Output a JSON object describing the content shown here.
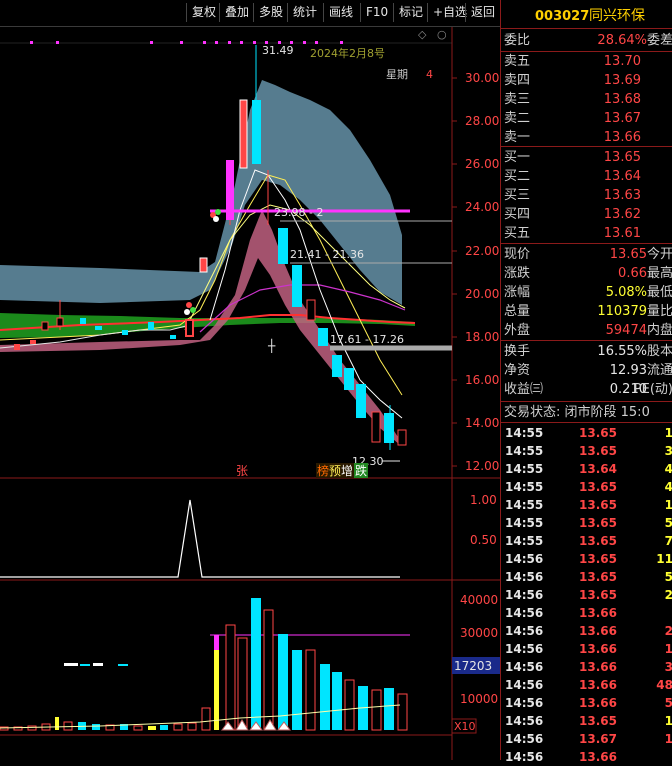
{
  "toolbar": {
    "items": [
      "复权",
      "叠加",
      "多股",
      "统计",
      "画线",
      "F10",
      "标记",
      "+自选",
      "返回"
    ]
  },
  "chart": {
    "price_axis": [
      "30.00",
      "28.00",
      "26.00",
      "24.00",
      "22.00",
      "20.00",
      "18.00",
      "16.00",
      "14.00",
      "12.00"
    ],
    "indicator_axis": [
      "1.00",
      "0.50"
    ],
    "volume_axis": [
      "40000",
      "30000",
      "20000",
      "10000"
    ],
    "volume_marker": "17203",
    "volume_scale": "X10",
    "high_label": "31.49",
    "low_label": "12.30",
    "date_label": "2024年2月8号",
    "weekday_label": "星期",
    "weekday_value": "4",
    "level_24": "23.98 - 2",
    "level_21": "21.41 - 21.36",
    "level_17": "17.61 - 17.26",
    "tag_zhang": "张",
    "tag_bang": "榜",
    "tag_yu": "预",
    "tag_zeng": "增",
    "tag_die": "跌"
  },
  "quote": {
    "code": "003027",
    "name": "同兴环保",
    "weibi": {
      "label": "委比",
      "value": "28.64%",
      "right": "委差"
    },
    "sells": [
      {
        "label": "卖五",
        "price": "13.70"
      },
      {
        "label": "卖四",
        "price": "13.69"
      },
      {
        "label": "卖三",
        "price": "13.68"
      },
      {
        "label": "卖二",
        "price": "13.67"
      },
      {
        "label": "卖一",
        "price": "13.66"
      }
    ],
    "buys": [
      {
        "label": "买一",
        "price": "13.65"
      },
      {
        "label": "买二",
        "price": "13.64"
      },
      {
        "label": "买三",
        "price": "13.63"
      },
      {
        "label": "买四",
        "price": "13.62"
      },
      {
        "label": "买五",
        "price": "13.61"
      }
    ],
    "stats": [
      {
        "label": "现价",
        "value": "13.65",
        "right": "今开",
        "color": "#ff4646"
      },
      {
        "label": "涨跌",
        "value": "0.66",
        "right": "最高",
        "color": "#ff4646"
      },
      {
        "label": "涨幅",
        "value": "5.08%",
        "right": "最低",
        "color": "#ffff33"
      },
      {
        "label": "总量",
        "value": "110379",
        "right": "量比",
        "color": "#ffff33"
      },
      {
        "label": "外盘",
        "value": "59474",
        "right": "内盘",
        "color": "#ff4646"
      }
    ],
    "stats2": [
      {
        "label": "换手",
        "value": "16.55%",
        "right": "股本",
        "color": "#e6e6e6"
      },
      {
        "label": "净资",
        "value": "12.93",
        "right": "流通",
        "color": "#e6e6e6"
      },
      {
        "label": "收益㈢",
        "value": "0.210",
        "right": "PE(动)",
        "color": "#e6e6e6"
      }
    ],
    "trade_status": "交易状态: 闭市阶段 15:0",
    "ticks": [
      {
        "t": "14:55",
        "p": "13.65",
        "v": "1",
        "pc": "#ff4646",
        "vc": "#ffff33"
      },
      {
        "t": "14:55",
        "p": "13.65",
        "v": "3",
        "pc": "#ff4646",
        "vc": "#ffff33"
      },
      {
        "t": "14:55",
        "p": "13.64",
        "v": "4",
        "pc": "#ff4646",
        "vc": "#ffff33"
      },
      {
        "t": "14:55",
        "p": "13.65",
        "v": "4",
        "pc": "#ff4646",
        "vc": "#ffff33"
      },
      {
        "t": "14:55",
        "p": "13.65",
        "v": "1",
        "pc": "#ff4646",
        "vc": "#ffff33"
      },
      {
        "t": "14:55",
        "p": "13.65",
        "v": "5",
        "pc": "#ff4646",
        "vc": "#ffff33"
      },
      {
        "t": "14:55",
        "p": "13.65",
        "v": "7",
        "pc": "#ff4646",
        "vc": "#ffff33"
      },
      {
        "t": "14:56",
        "p": "13.65",
        "v": "11",
        "pc": "#ff4646",
        "vc": "#ffff33"
      },
      {
        "t": "14:56",
        "p": "13.65",
        "v": "5",
        "pc": "#ff4646",
        "vc": "#ffff33"
      },
      {
        "t": "14:56",
        "p": "13.65",
        "v": "2",
        "pc": "#ff4646",
        "vc": "#ffff33"
      },
      {
        "t": "14:56",
        "p": "13.66",
        "v": "",
        "pc": "#ff4646",
        "vc": "#ffff33"
      },
      {
        "t": "14:56",
        "p": "13.66",
        "v": "2",
        "pc": "#ff4646",
        "vc": "#ff4646"
      },
      {
        "t": "14:56",
        "p": "13.66",
        "v": "1",
        "pc": "#ff4646",
        "vc": "#ff4646"
      },
      {
        "t": "14:56",
        "p": "13.66",
        "v": "3",
        "pc": "#ff4646",
        "vc": "#ff4646"
      },
      {
        "t": "14:56",
        "p": "13.66",
        "v": "48",
        "pc": "#ff4646",
        "vc": "#ff4646"
      },
      {
        "t": "14:56",
        "p": "13.66",
        "v": "5",
        "pc": "#ff4646",
        "vc": "#ff4646"
      },
      {
        "t": "14:56",
        "p": "13.65",
        "v": "1",
        "pc": "#ff4646",
        "vc": "#ffff33"
      },
      {
        "t": "14:56",
        "p": "13.67",
        "v": "1",
        "pc": "#ff4646",
        "vc": "#ff4646"
      },
      {
        "t": "14:56",
        "p": "13.66",
        "v": "",
        "pc": "#ff4646",
        "vc": "#ff4646"
      }
    ]
  }
}
